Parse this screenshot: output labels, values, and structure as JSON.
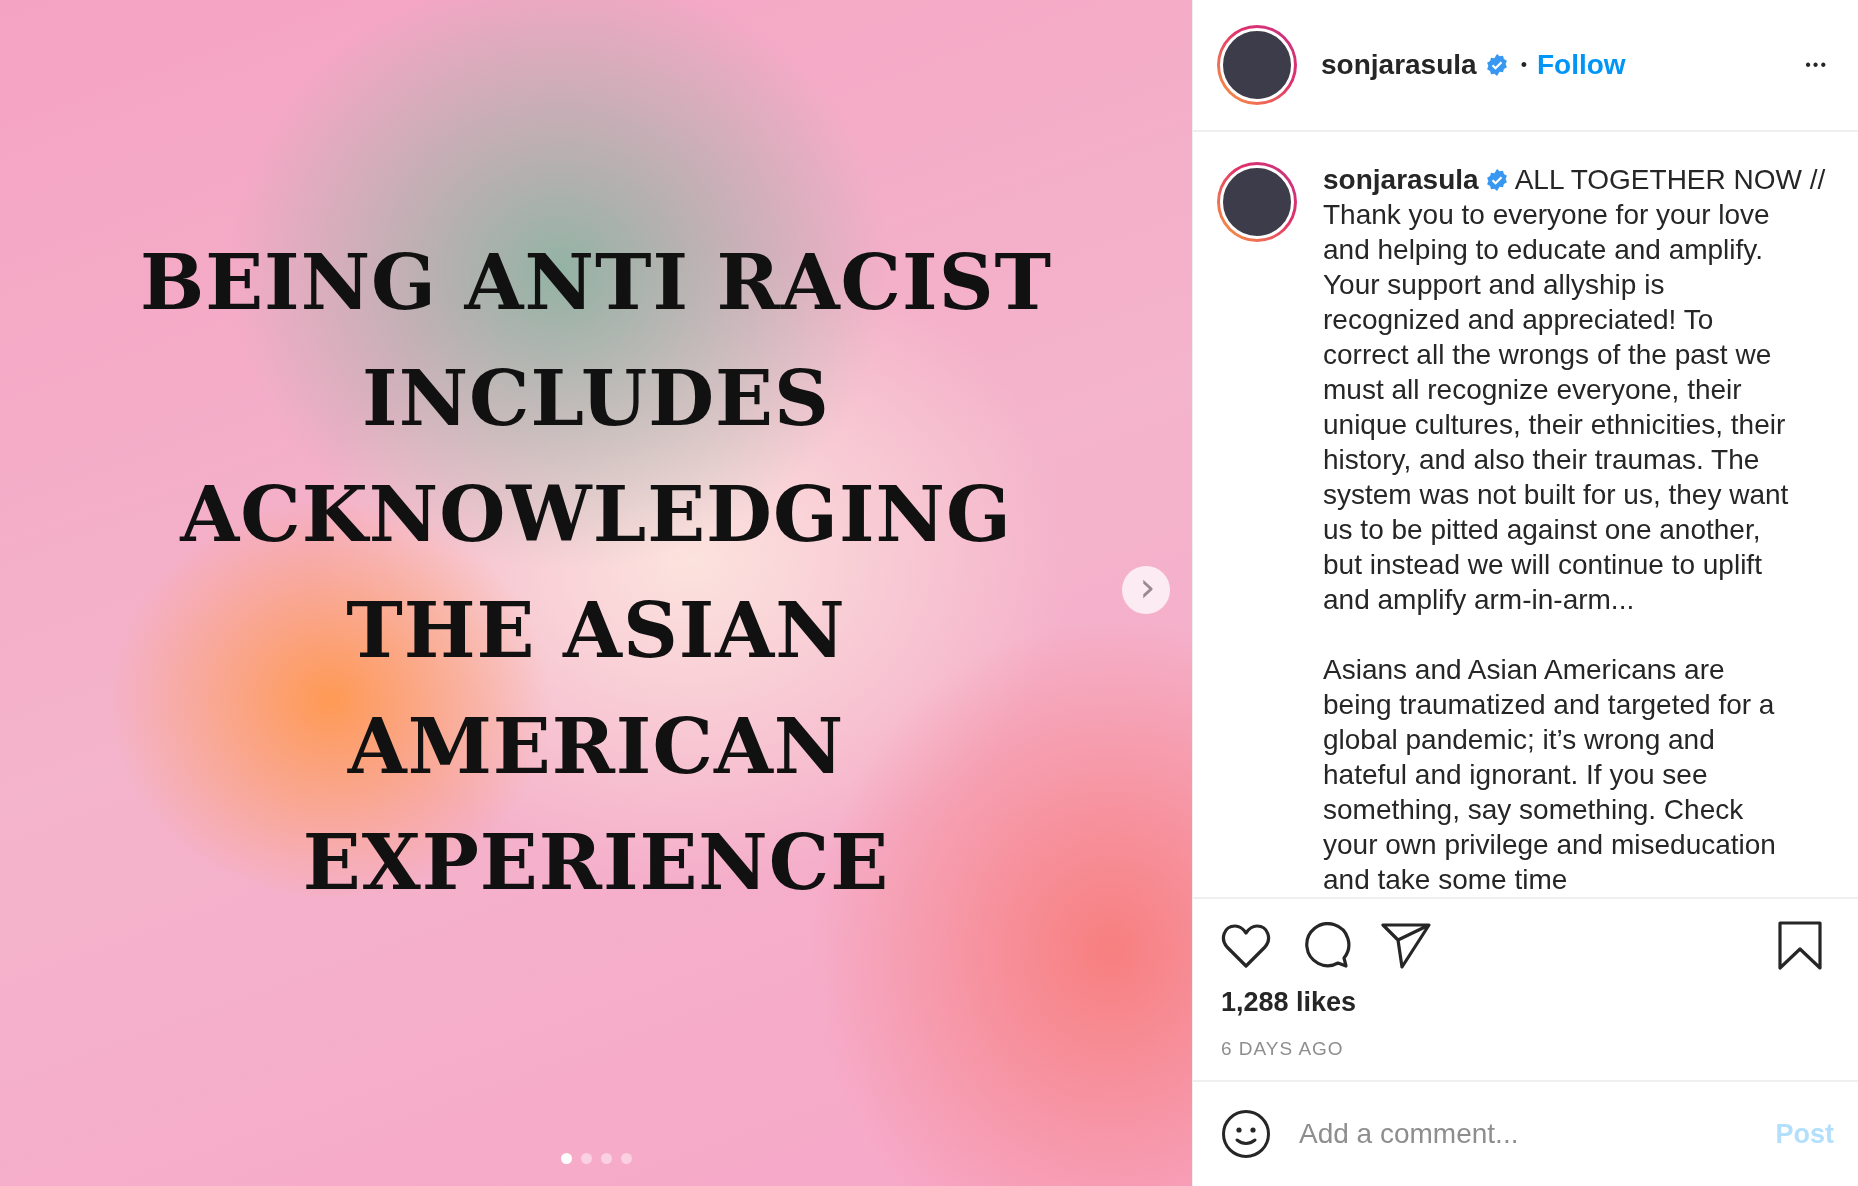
{
  "post_image": {
    "heading_lines": [
      "BEING ANTI RACIST",
      "INCLUDES",
      "ACKNOWLEDGING",
      "THE ASIAN",
      "AMERICAN",
      "EXPERIENCE"
    ],
    "next_arrow": "›",
    "slides": [
      {
        "selected": true
      },
      {
        "selected": false
      },
      {
        "selected": false
      },
      {
        "selected": false
      }
    ]
  },
  "header": {
    "username": "sonjarasula",
    "verified": true,
    "separator": "•",
    "follow": "Follow",
    "more": "•••"
  },
  "caption": {
    "username": "sonjarasula",
    "verified": true,
    "lead": "ALL TOGETHER NOW //",
    "paragraphs": [
      "Thank you to everyone for your love and helping to educate and amplify. Your support and allyship is recognized and appreciated! To correct all the wrongs of the past we must all recognize everyone, their unique cultures, their ethnicities, their history, and also their traumas. The system was not built for us, they want us to be pitted against one another, but instead we will continue to uplift and amplify arm-in-arm...",
      "Asians and Asian Americans are being traumatized and targeted for a global pandemic; it’s wrong and hateful and ignorant. If you see something, say something. Check your own privilege and miseducation and take some time"
    ]
  },
  "actions": {
    "liked": false,
    "saved": false,
    "likes": "1,288 likes",
    "time": "6 DAYS AGO"
  },
  "comment": {
    "placeholder": "Add a comment...",
    "post": "Post",
    "post_disabled": true
  }
}
